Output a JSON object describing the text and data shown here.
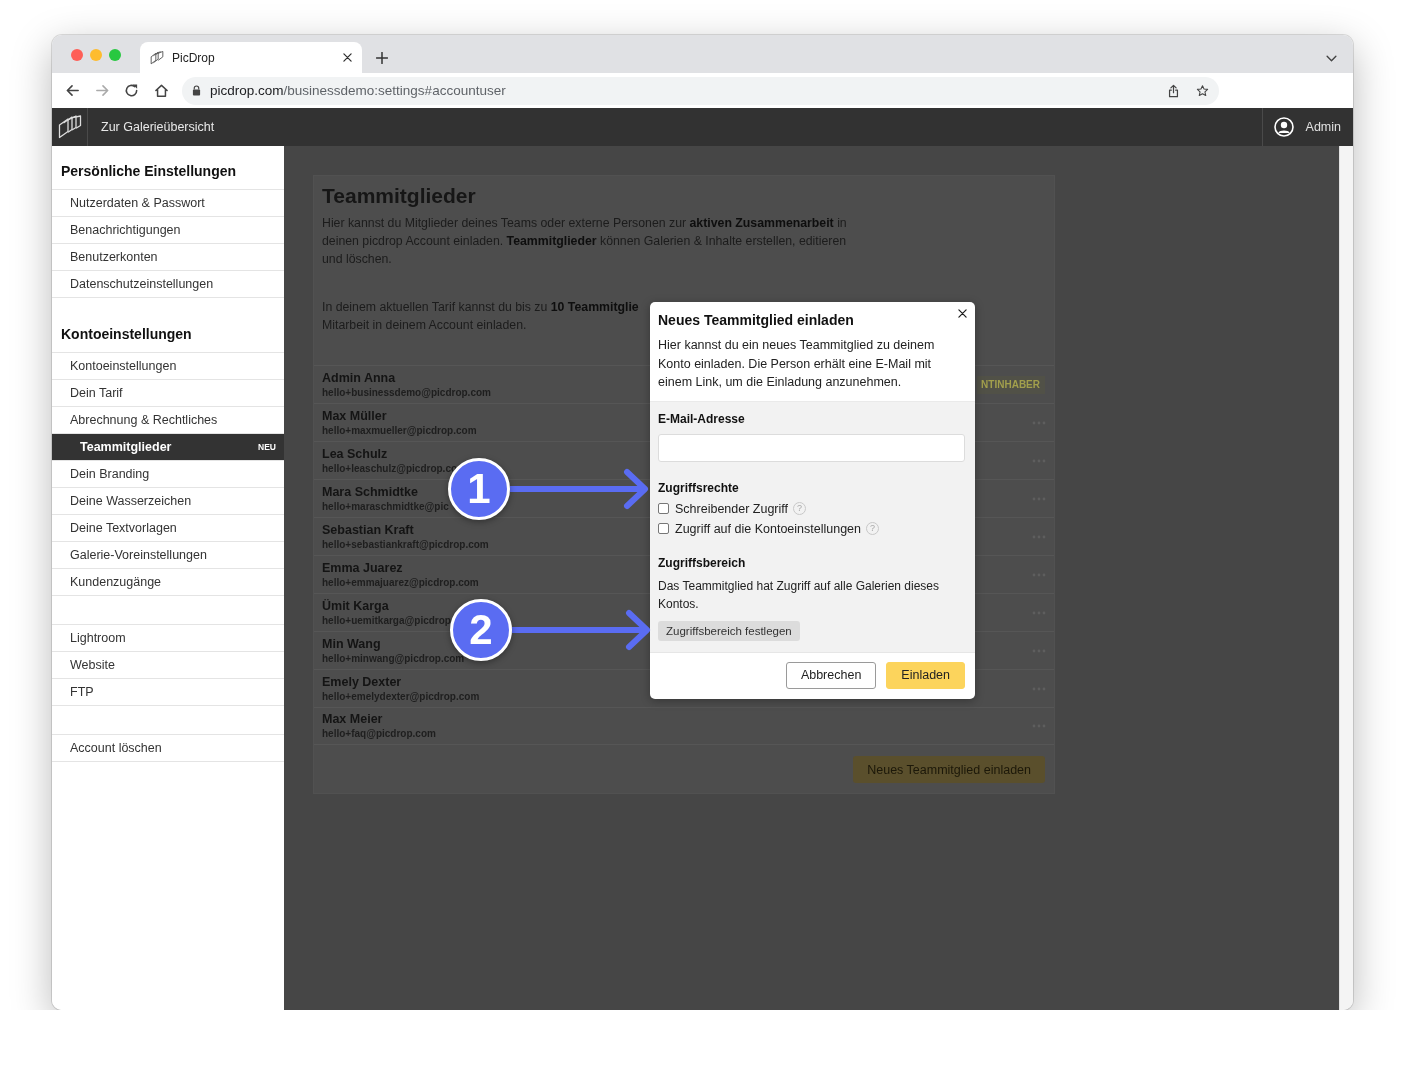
{
  "browser": {
    "tab_title": "PicDrop",
    "url_host": "picdrop.com",
    "url_path": "/businessdemo:settings#accountuser"
  },
  "app_header": {
    "back_link": "Zur Galerieübersicht",
    "user": "Admin"
  },
  "sidebar": {
    "groups": [
      {
        "title": "Persönliche Einstellungen",
        "items": [
          {
            "label": "Nutzerdaten & Passwort",
            "selected": false
          },
          {
            "label": "Benachrichtigungen",
            "selected": false
          },
          {
            "label": "Benutzerkonten",
            "selected": false
          },
          {
            "label": "Datenschutzeinstellungen",
            "selected": false
          }
        ]
      },
      {
        "title": "Kontoeinstellungen",
        "items": [
          {
            "label": "Kontoeinstellungen",
            "selected": false
          },
          {
            "label": "Dein Tarif",
            "selected": false
          },
          {
            "label": "Abrechnung & Rechtliches",
            "selected": false
          },
          {
            "label": "Teammitglieder",
            "selected": true,
            "badge": "NEU"
          },
          {
            "label": "Dein Branding",
            "selected": false
          },
          {
            "label": "Deine Wasserzeichen",
            "selected": false
          },
          {
            "label": "Deine Textvorlagen",
            "selected": false
          },
          {
            "label": "Galerie-Voreinstellungen",
            "selected": false
          },
          {
            "label": "Kundenzugänge",
            "selected": false
          }
        ]
      },
      {
        "items": [
          {
            "label": "Lightroom",
            "selected": false
          },
          {
            "label": "Website",
            "selected": false
          },
          {
            "label": "FTP",
            "selected": false
          }
        ]
      },
      {
        "items": [
          {
            "label": "Account löschen",
            "selected": false
          }
        ]
      }
    ]
  },
  "page": {
    "title": "Teammitglieder",
    "intro": "Hier kannst du Mitglieder deines Teams oder externe Personen zur **aktiven Zusammenarbeit** in deinen picdrop Account einladen. **Teammitglieder** können Galerien & Inhalte erstellen, editieren und löschen.",
    "plan_note_lines": [
      "In deinem aktuellen Tarif kannst du bis zu **10 Teammitglie**",
      "Mitarbeit in deinem Account einladen."
    ],
    "members": [
      {
        "name": "Admin Anna",
        "email": "hello+businessdemo@picdrop.com",
        "role": "NTINHABER"
      },
      {
        "name": "Max Müller",
        "email": "hello+maxmueller@picdrop.com"
      },
      {
        "name": "Lea Schulz",
        "email": "hello+leaschulz@picdrop.co"
      },
      {
        "name": "Mara Schmidtke",
        "email": "hello+maraschmidtke@pic"
      },
      {
        "name": "Sebastian Kraft",
        "email": "hello+sebastiankraft@picdrop.com"
      },
      {
        "name": "Emma Juarez",
        "email": "hello+emmajuarez@picdrop.com"
      },
      {
        "name": "Ümit Karga",
        "email": "hello+uemitkarga@picdrop"
      },
      {
        "name": "Min Wang",
        "email": "hello+minwang@picdrop.com"
      },
      {
        "name": "Emely Dexter",
        "email": "hello+emelydexter@picdrop.com"
      },
      {
        "name": "Max Meier",
        "email": "hello+faq@picdrop.com"
      }
    ],
    "invite_button": "Neues Teammitglied einladen"
  },
  "dialog": {
    "title": "Neues Teammitglied einladen",
    "description": "Hier kannst du ein neues Teammitglied zu deinem Konto einladen. Die Person erhält eine E-Mail mit einem Link, um die Einladung anzunehmen.",
    "email_label": "E-Mail-Adresse",
    "permissions_heading": "Zugriffsrechte",
    "permissions": [
      {
        "label": "Schreibender Zugriff",
        "checked": false,
        "help": "?"
      },
      {
        "label": "Zugriff auf die Kontoeinstellungen",
        "checked": false,
        "help": "?"
      }
    ],
    "scope_heading": "Zugriffsbereich",
    "scope_text": "Das Teammitglied hat Zugriff auf alle Galerien dieses Kontos.",
    "scope_button": "Zugriffsbereich festlegen",
    "buttons": [
      {
        "label": "Abbrechen",
        "kind": "secondary"
      },
      {
        "label": "Einladen",
        "kind": "primary"
      }
    ]
  },
  "annotations": [
    {
      "number": "1"
    },
    {
      "number": "2"
    }
  ]
}
